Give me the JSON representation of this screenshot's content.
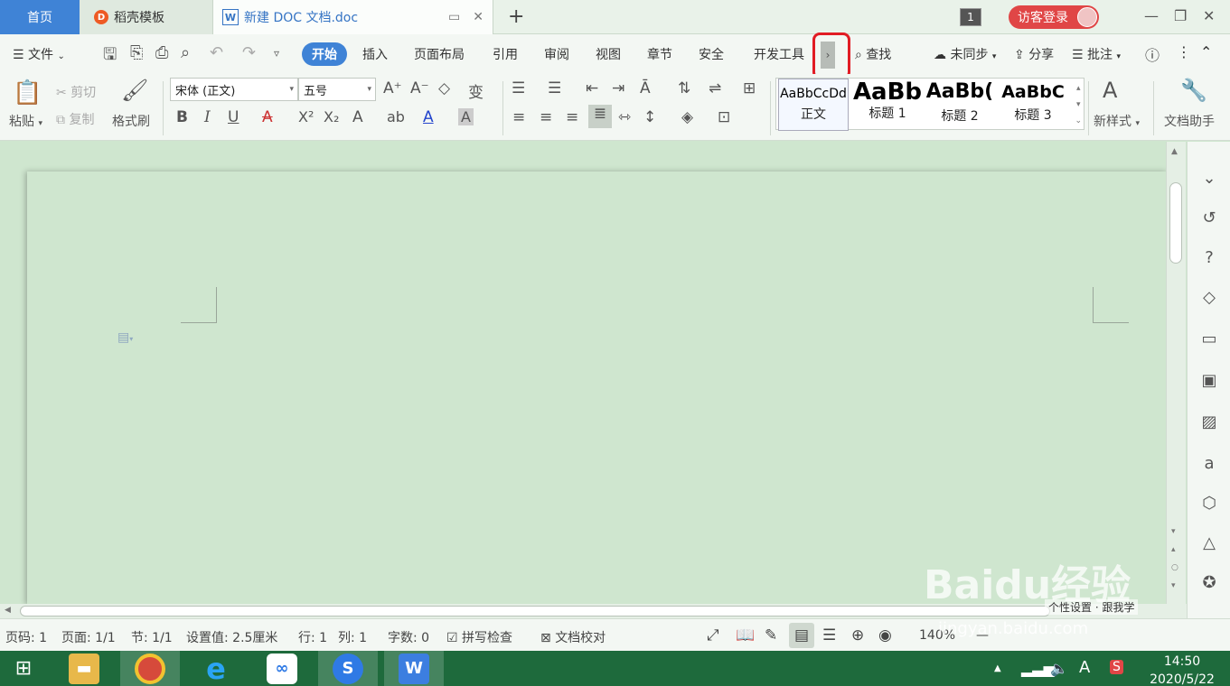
{
  "tabs": {
    "home": "首页",
    "templates": "稻壳模板",
    "document": "新建 DOC 文档.doc",
    "window_count": "1",
    "guest_login": "访客登录"
  },
  "menu": {
    "file": "文件",
    "items": [
      "开始",
      "插入",
      "页面布局",
      "引用",
      "审阅",
      "视图",
      "章节",
      "安全",
      "开发工具"
    ],
    "find": "查找",
    "sync": "未同步",
    "share": "分享",
    "comment": "批注"
  },
  "ribbon": {
    "paste": "粘贴",
    "cut": "剪切",
    "copy": "复制",
    "format_painter": "格式刷",
    "font_name": "宋体 (正文)",
    "font_size": "五号",
    "styles": [
      {
        "preview": "AaBbCcDd",
        "name": "正文"
      },
      {
        "preview": "AaBb",
        "name": "标题 1"
      },
      {
        "preview": "AaBb(",
        "name": "标题 2"
      },
      {
        "preview": "AaBbC",
        "name": "标题 3"
      }
    ],
    "new_style": "新样式",
    "doc_assistant": "文档助手"
  },
  "status": {
    "page_num": "页码: 1",
    "pages": "页面: 1/1",
    "section": "节: 1/1",
    "setting": "设置值: 2.5厘米",
    "row": "行: 1",
    "col": "列: 1",
    "word_count": "字数: 0",
    "spell_check": "拼写检查",
    "proofread": "文档校对",
    "zoom": "140%"
  },
  "taskbar": {
    "time": "14:50",
    "date": "2020/5/22"
  },
  "watermark": {
    "logo": "Baidu经验",
    "url": "jingyan.baidu.com",
    "tip": "个性设置 · 跟我学"
  },
  "colors": {
    "accent": "#3f83d6",
    "guest": "#e04646",
    "highlight": "#e11c24",
    "doc_bg": "#cfe6cf",
    "taskbar": "#1e6a3c"
  }
}
